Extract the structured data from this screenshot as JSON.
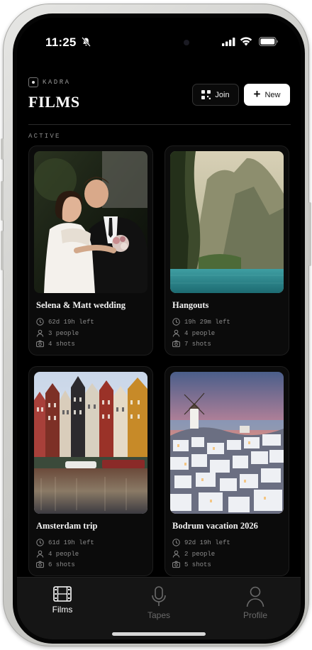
{
  "status": {
    "time": "11:25"
  },
  "brand": {
    "name": "KADRA"
  },
  "page": {
    "title": "FILMS"
  },
  "toolbar": {
    "join_label": "Join",
    "new_label": "New"
  },
  "section": {
    "label": "ACTIVE"
  },
  "films": [
    {
      "title": "Selena & Matt wedding",
      "time_left": "62d 19h left",
      "people": "3 people",
      "shots": "4 shots",
      "image": "wedding-couple-photo"
    },
    {
      "title": "Hangouts",
      "time_left": "19h 29m left",
      "people": "4 people",
      "shots": "7 shots",
      "image": "cliffs-lagoon-photo"
    },
    {
      "title": "Amsterdam trip",
      "time_left": "61d 19h left",
      "people": "4 people",
      "shots": "6 shots",
      "image": "canal-houses-photo"
    },
    {
      "title": "Bodrum vacation 2026",
      "time_left": "92d 19h left",
      "people": "2 people",
      "shots": "5 shots",
      "image": "whitewashed-village-sunset-photo"
    }
  ],
  "tabs": [
    {
      "label": "Films",
      "icon": "film-icon",
      "active": true
    },
    {
      "label": "Tapes",
      "icon": "mic-icon",
      "active": false
    },
    {
      "label": "Profile",
      "icon": "person-icon",
      "active": false
    }
  ],
  "colors": {
    "background": "#000000",
    "card": "#0b0b0b",
    "text": "#ffffff",
    "muted": "#8b8b8b",
    "tabbar": "#151515"
  }
}
